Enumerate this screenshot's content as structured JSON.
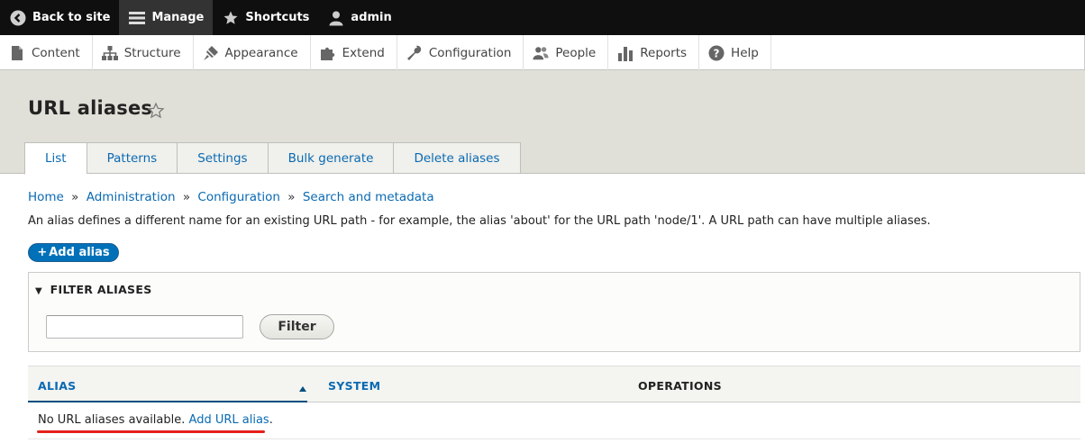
{
  "toolbar": {
    "back_label": "Back to site",
    "manage_label": "Manage",
    "shortcuts_label": "Shortcuts",
    "user_label": "admin"
  },
  "tray": {
    "items": [
      {
        "label": "Content",
        "icon": "file-icon"
      },
      {
        "label": "Structure",
        "icon": "structure-icon"
      },
      {
        "label": "Appearance",
        "icon": "paintbrush-icon"
      },
      {
        "label": "Extend",
        "icon": "puzzle-icon"
      },
      {
        "label": "Configuration",
        "icon": "wrench-icon"
      },
      {
        "label": "People",
        "icon": "people-icon"
      },
      {
        "label": "Reports",
        "icon": "bar-chart-icon"
      },
      {
        "label": "Help",
        "icon": "help-icon"
      }
    ]
  },
  "header": {
    "title": "URL aliases"
  },
  "tabs": [
    {
      "label": "List",
      "active": true
    },
    {
      "label": "Patterns",
      "active": false
    },
    {
      "label": "Settings",
      "active": false
    },
    {
      "label": "Bulk generate",
      "active": false
    },
    {
      "label": "Delete aliases",
      "active": false
    }
  ],
  "breadcrumb": [
    "Home",
    "Administration",
    "Configuration",
    "Search and metadata"
  ],
  "breadcrumb_separator": "»",
  "description": "An alias defines a different name for an existing URL path - for example, the alias 'about' for the URL path 'node/1'. A URL path can have multiple aliases.",
  "add_button_label": "Add alias",
  "add_button_prefix": "+",
  "filter": {
    "legend": "FILTER ALIASES",
    "toggle_glyph": "▼",
    "input_value": "",
    "button_label": "Filter"
  },
  "table": {
    "columns": [
      "ALIAS",
      "SYSTEM",
      "OPERATIONS"
    ],
    "sort_glyph": "▲",
    "empty_text": "No URL aliases available.",
    "empty_link": "Add URL alias",
    "empty_suffix": "."
  },
  "colors": {
    "link": "#0a6ab3",
    "primary_button": "#0071b8",
    "highlight_underline": "#e5201b",
    "toolbar": "#0f0f0f",
    "header_bg": "#e0e0d8"
  }
}
